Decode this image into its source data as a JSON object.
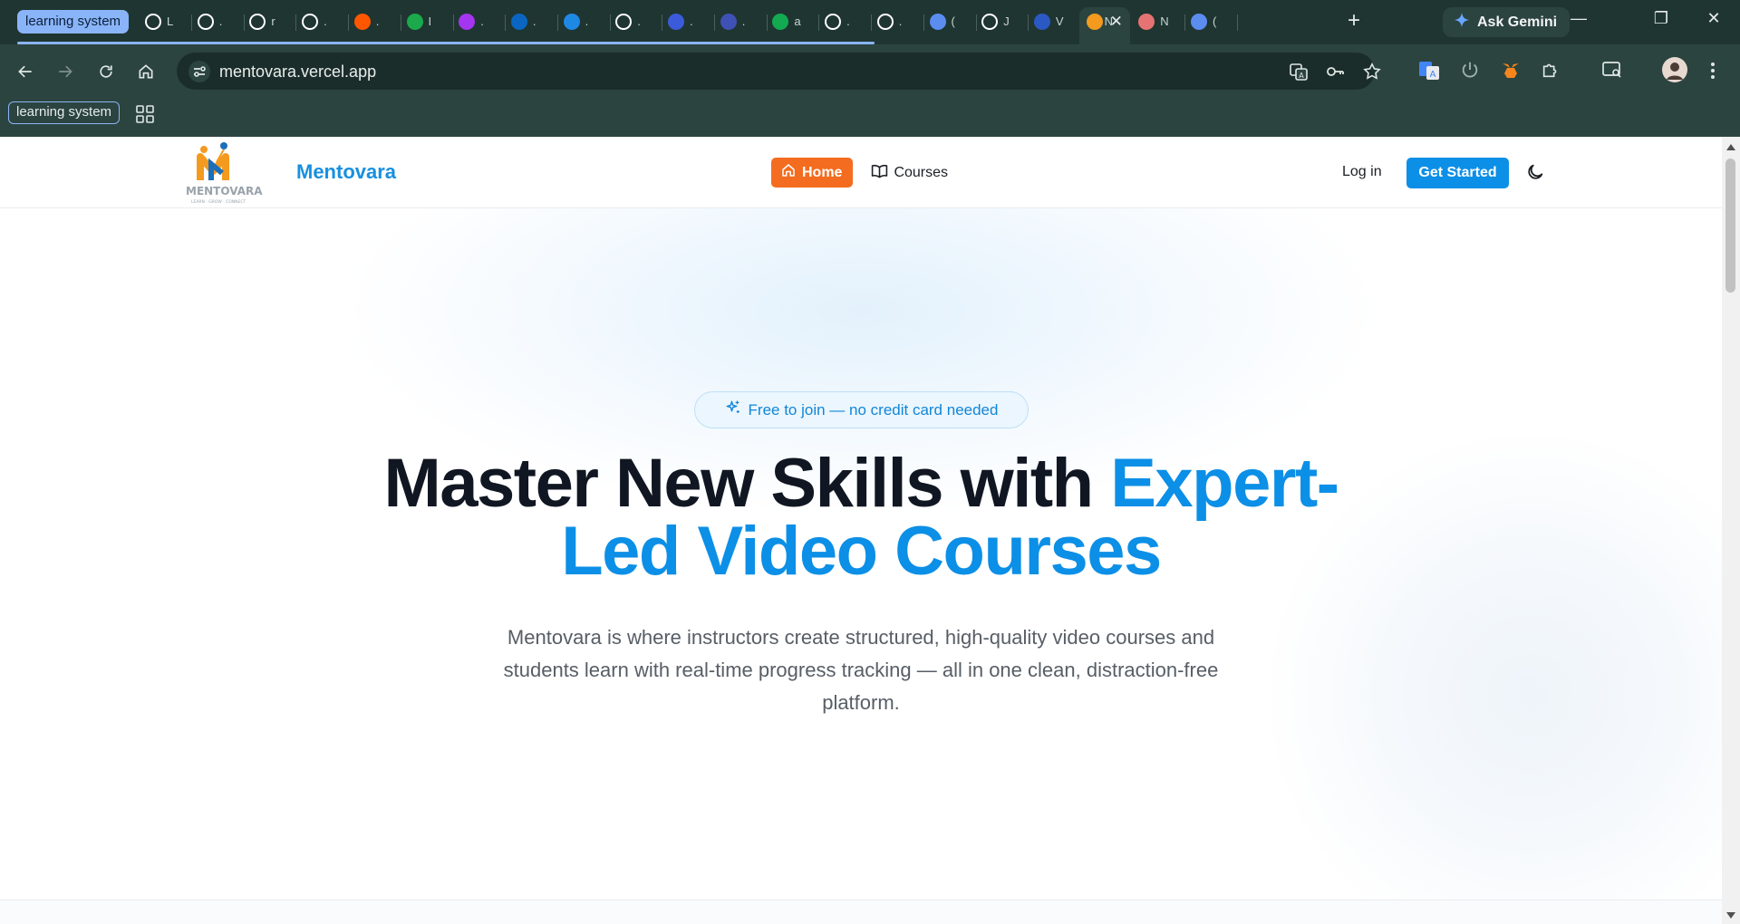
{
  "browser": {
    "tab_group_label": "learning system",
    "tabs": [
      {
        "icon": "openai-icon",
        "title": "L"
      },
      {
        "icon": "github-icon",
        "title": "."
      },
      {
        "icon": "vercel-icon",
        "title": "r"
      },
      {
        "icon": "puzzle-app-icon",
        "title": "."
      },
      {
        "icon": "reddit-icon",
        "title": "."
      },
      {
        "icon": "hackerrank-icon",
        "title": "I"
      },
      {
        "icon": "udemy-icon",
        "title": "."
      },
      {
        "icon": "linkedin-icon",
        "title": "."
      },
      {
        "icon": "is-icon",
        "title": "."
      },
      {
        "icon": "info-icon",
        "title": "."
      },
      {
        "icon": "kotlin-icon",
        "title": "."
      },
      {
        "icon": "dashboard-icon",
        "title": "."
      },
      {
        "icon": "mongodb-icon",
        "title": "a"
      },
      {
        "icon": "anthropic-icon",
        "title": "."
      },
      {
        "icon": "openai-alt-icon",
        "title": "."
      },
      {
        "icon": "gemini-icon",
        "title": "("
      },
      {
        "icon": "chatgpt-icon",
        "title": "J"
      },
      {
        "icon": "r-icon",
        "title": "V"
      },
      {
        "icon": "mentovara-icon",
        "title": "N",
        "active": true
      },
      {
        "icon": "figure-icon",
        "title": "N"
      },
      {
        "icon": "gemini-icon",
        "title": "("
      }
    ],
    "new_tab_label": "+",
    "ask_gemini_label": "Ask Gemini",
    "window_controls": {
      "minimize": "—",
      "restore": "❐",
      "close": "✕"
    },
    "url": "mentovara.vercel.app",
    "bookmark_group_label": "learning system"
  },
  "site": {
    "brand_name": "Mentovara",
    "logo_text": "MENTOVARA",
    "logo_tagline": "LEARN · GROW · CONNECT",
    "nav": {
      "home_label": "Home",
      "courses_label": "Courses"
    },
    "login_label": "Log in",
    "get_started_label": "Get Started",
    "accent_color": "#0c8fe6",
    "home_button_color": "#f46c1f"
  },
  "hero": {
    "badge_text": "Free to join — no credit card needed",
    "headline_main": "Master New Skills with",
    "headline_accent_1": "Expert-",
    "headline_accent_2": "Led Video Courses",
    "subtext": "Mentovara is where instructors create structured, high-quality video courses and students learn with real-time progress tracking — all in one clean, distraction-free platform."
  }
}
